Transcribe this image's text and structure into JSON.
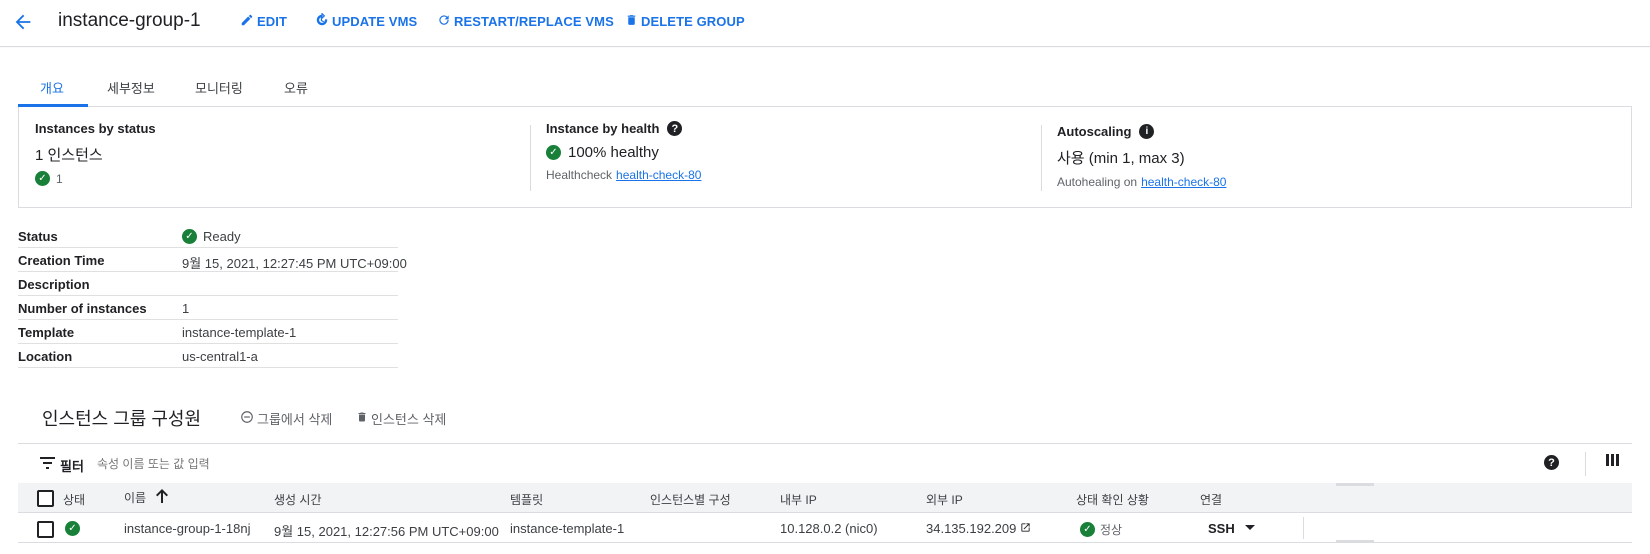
{
  "header": {
    "title": "instance-group-1",
    "actions": {
      "edit": "EDIT",
      "update": "UPDATE VMS",
      "restart": "RESTART/REPLACE VMS",
      "delete": "DELETE GROUP"
    }
  },
  "tabs": [
    "개요",
    "세부정보",
    "모니터링",
    "오류"
  ],
  "summary": {
    "status": {
      "title": "Instances by status",
      "count": "1 인스턴스",
      "ok": "1"
    },
    "health": {
      "title": "Instance by health",
      "value": "100% healthy",
      "check_label": "Healthcheck",
      "check_link": "health-check-80"
    },
    "autoscaling": {
      "title": "Autoscaling",
      "value": "사용 (min 1, max 3)",
      "heal_label": "Autohealing on",
      "heal_link": "health-check-80"
    }
  },
  "details": [
    {
      "key": "Status",
      "value": "Ready"
    },
    {
      "key": "Creation Time",
      "value": "9월 15, 2021, 12:27:45 PM UTC+09:00"
    },
    {
      "key": "Description",
      "value": ""
    },
    {
      "key": "Number of instances",
      "value": "1"
    },
    {
      "key": "Template",
      "value": "instance-template-1"
    },
    {
      "key": "Location",
      "value": "us-central1-a"
    }
  ],
  "members": {
    "title": "인스턴스 그룹 구성원",
    "remove_from_group": "그룹에서 삭제",
    "delete_instance": "인스턴스 삭제",
    "filter_label": "필터",
    "filter_placeholder": "속성 이름 또는 값 입력",
    "columns": [
      "상태",
      "이름",
      "생성 시간",
      "템플릿",
      "인스턴스별 구성",
      "내부 IP",
      "외부 IP",
      "상태 확인 상황",
      "연결"
    ],
    "rows": [
      {
        "name": "instance-group-1-18nj",
        "created": "9월 15, 2021, 12:27:56 PM UTC+09:00",
        "template": "instance-template-1",
        "per_instance": "",
        "internal_ip": "10.128.0.2 (nic0)",
        "external_ip": "34.135.192.209",
        "health": "정상",
        "connect": "SSH"
      }
    ]
  },
  "colors": {
    "accent": "#1a73e8",
    "ok": "#188038"
  }
}
